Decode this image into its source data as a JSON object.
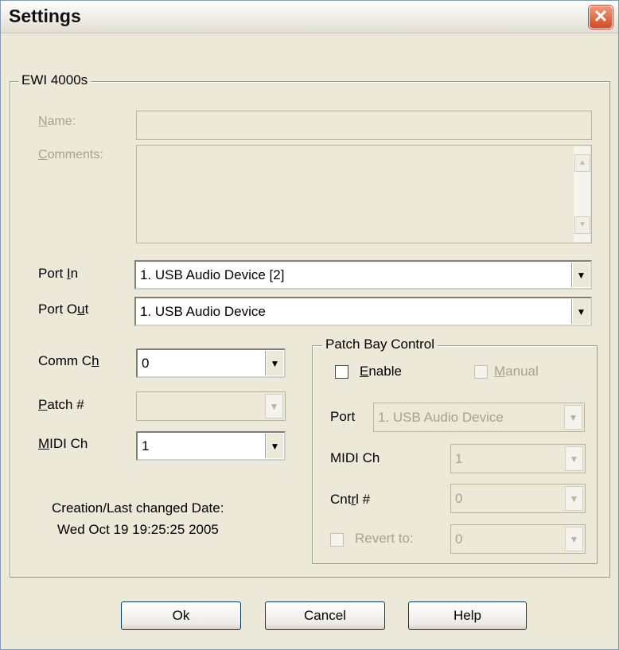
{
  "window": {
    "title": "Settings",
    "close_glyph": "✕"
  },
  "device_group": {
    "legend": "EWI 4000s",
    "name_label": "Name:",
    "name_value": "",
    "comments_label": "Comments:",
    "comments_value": "",
    "port_in_label": "Port In",
    "port_in_value": "1. USB Audio Device [2]",
    "port_out_label": "Port Out",
    "port_out_value": "1. USB Audio Device",
    "comm_ch_label": "Comm Ch",
    "comm_ch_value": "0",
    "patch_label": "Patch #",
    "patch_value": "",
    "midi_ch_label": "MIDI Ch",
    "midi_ch_value": "1",
    "date_caption": "Creation/Last changed Date:",
    "date_value": "Wed Oct 19 19:25:25 2005"
  },
  "patch_bay": {
    "legend": "Patch Bay Control",
    "enable_label": "Enable",
    "enable_checked": false,
    "manual_label": "Manual",
    "port_label": "Port",
    "port_value": "1. USB Audio Device",
    "midi_ch_label": "MIDI Ch",
    "midi_ch_value": "1",
    "cntrl_label": "Cntrl #",
    "cntrl_value": "0",
    "revert_label": "Revert to:",
    "revert_value": "0"
  },
  "buttons": {
    "ok": "Ok",
    "cancel": "Cancel",
    "help": "Help"
  },
  "icons": {
    "dropdown": "▼",
    "scroll_up": "▲",
    "scroll_down": "▼"
  }
}
